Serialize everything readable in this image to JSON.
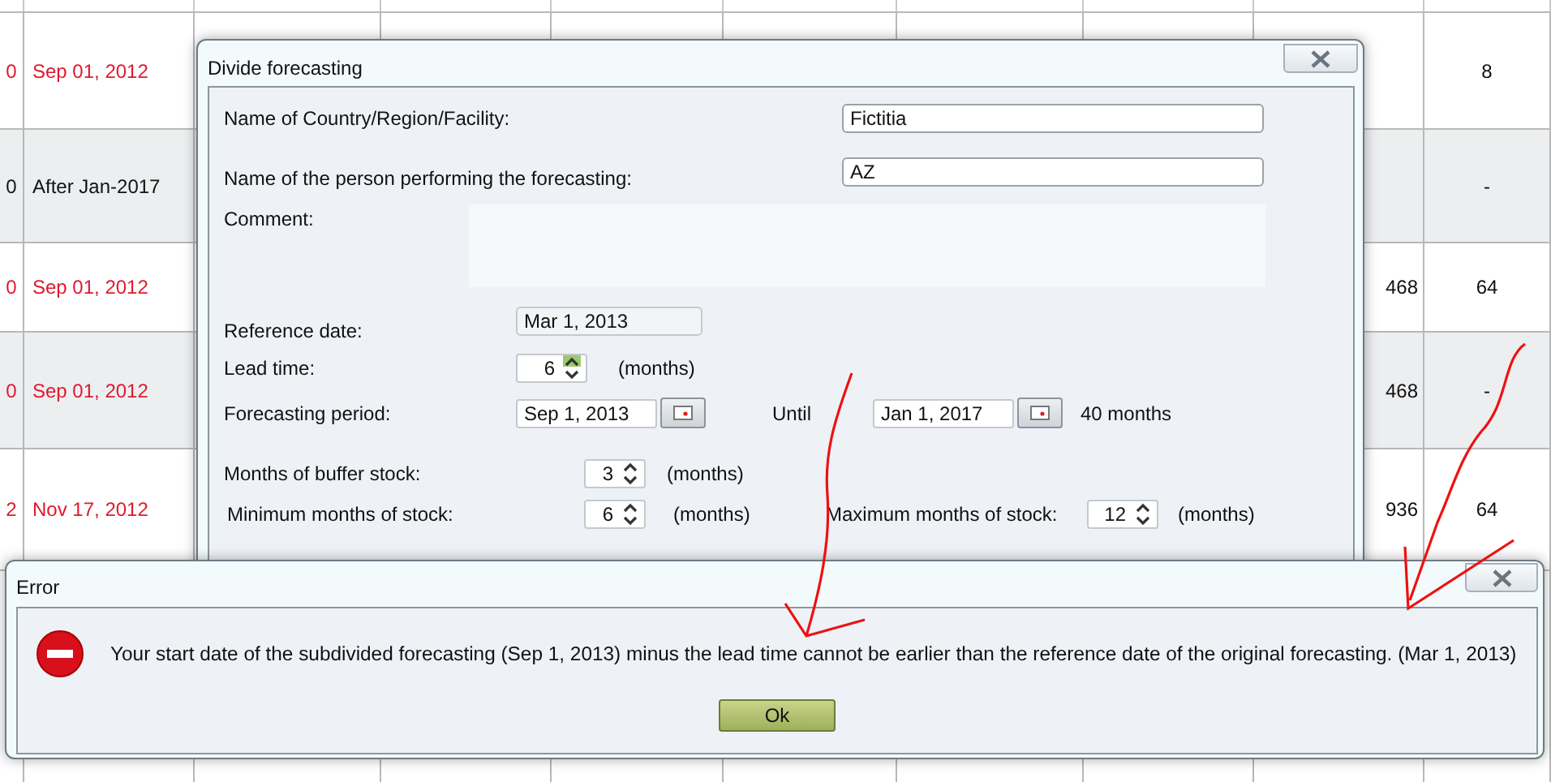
{
  "table": {
    "rows": [
      {
        "count": "0",
        "date": "Sep 01, 2012",
        "flagged": true,
        "column_10": "8"
      },
      {
        "count": "0",
        "date": "After Jan-2017",
        "flagged": false,
        "column_10": "-"
      },
      {
        "count": "0",
        "date": "Sep 01, 2012",
        "flagged": true,
        "column_9": "468",
        "column_10": "64"
      },
      {
        "count": "0",
        "date": "Sep 01, 2012",
        "flagged": true,
        "column_9": "468",
        "column_10": "-"
      },
      {
        "count": "2",
        "date": "Nov 17, 2012",
        "flagged": true,
        "column_9": "936",
        "column_10": "64"
      }
    ]
  },
  "divide_dialog": {
    "title": "Divide forecasting",
    "country": {
      "label": "Name of Country/Region/Facility:",
      "value": "Fictitia"
    },
    "person": {
      "label": "Name of the person performing the forecasting:",
      "value": "AZ"
    },
    "comment": {
      "label": "Comment:"
    },
    "reference_date": {
      "label": "Reference date:",
      "value": "Mar 1, 2013"
    },
    "lead_time": {
      "label": "Lead time:",
      "value": "6",
      "unit": "(months)"
    },
    "forecasting_period": {
      "label": "Forecasting period:",
      "from": "Sep 1, 2013",
      "until_label": "Until",
      "until": "Jan 1, 2017",
      "duration": "40 months"
    },
    "buffer_stock": {
      "label": "Months of buffer stock:",
      "value": "3",
      "unit": "(months)"
    },
    "minimum_stock": {
      "label": "Minimum months of stock:",
      "value": "6",
      "unit": "(months)"
    },
    "maximum_stock": {
      "label": "Maximum months of stock:",
      "value": "12",
      "unit": "(months)"
    }
  },
  "error_dialog": {
    "title": "Error",
    "message": "Your start date of the subdivided forecasting (Sep 1, 2013) minus the lead time cannot be earlier than the reference date of the original forecasting. (Mar 1, 2013)",
    "button": "Ok"
  }
}
